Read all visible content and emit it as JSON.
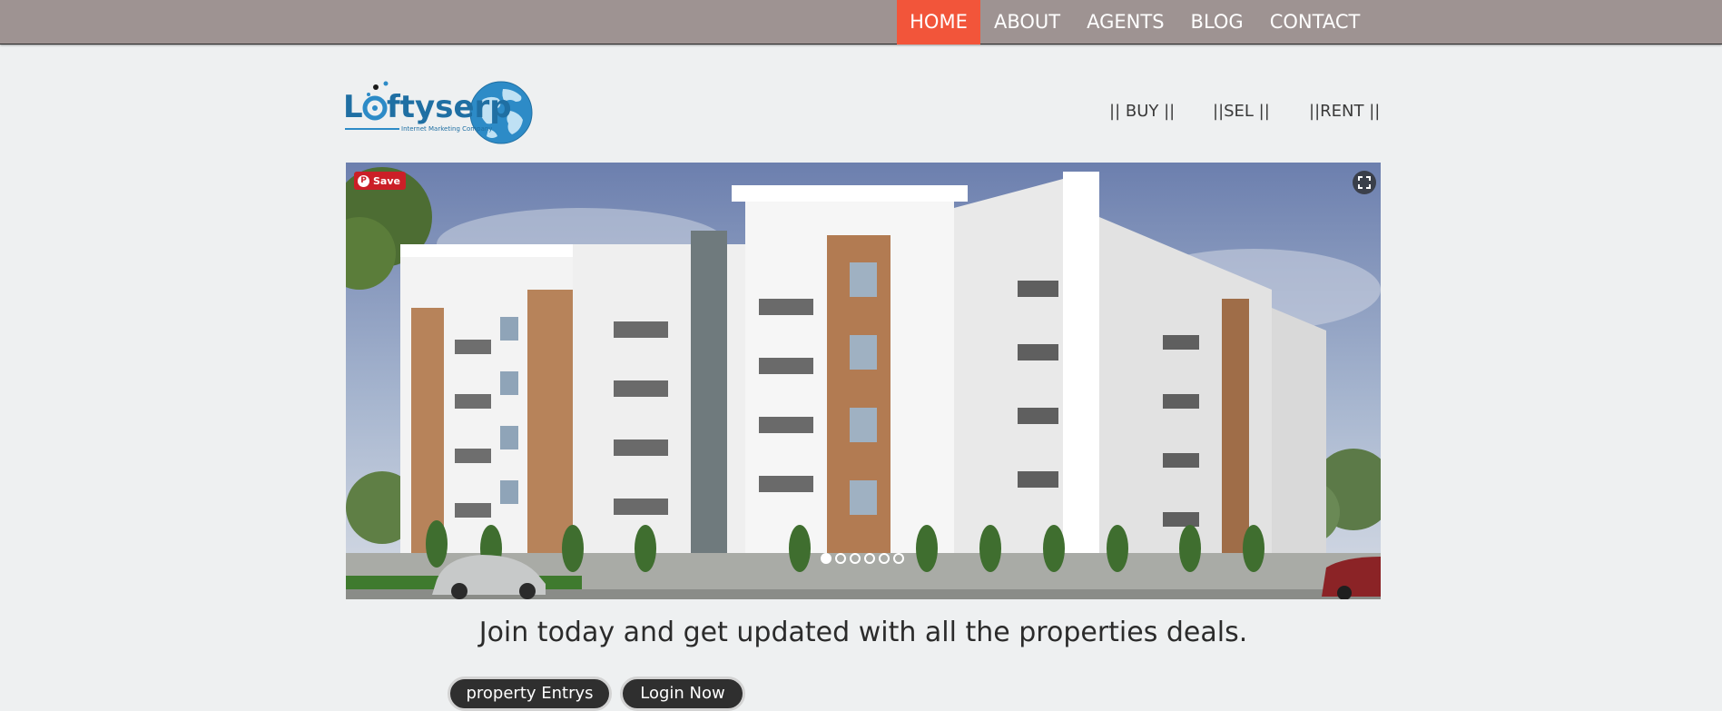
{
  "topnav": {
    "items": [
      {
        "label": "HOME",
        "active": true
      },
      {
        "label": "ABOUT",
        "active": false
      },
      {
        "label": "AGENTS",
        "active": false
      },
      {
        "label": "BLOG",
        "active": false
      },
      {
        "label": "CONTACT",
        "active": false
      }
    ],
    "active_color": "#f2553a",
    "bar_color": "#9e9392"
  },
  "logo": {
    "text": "Loftyserp",
    "tagline": "Internet Marketing Company"
  },
  "subnav": {
    "buy": "|| BUY ||",
    "sell": "||SEL ||",
    "rent": "||RENT ||"
  },
  "slider": {
    "pin_save_label": "Save",
    "slide_count": 6,
    "active_slide": 1,
    "image_description": "apartment-building-render"
  },
  "main": {
    "tagline": "Join today and get updated with all the properties deals.",
    "property_button": "property Entrys",
    "login_button": "Login Now"
  }
}
